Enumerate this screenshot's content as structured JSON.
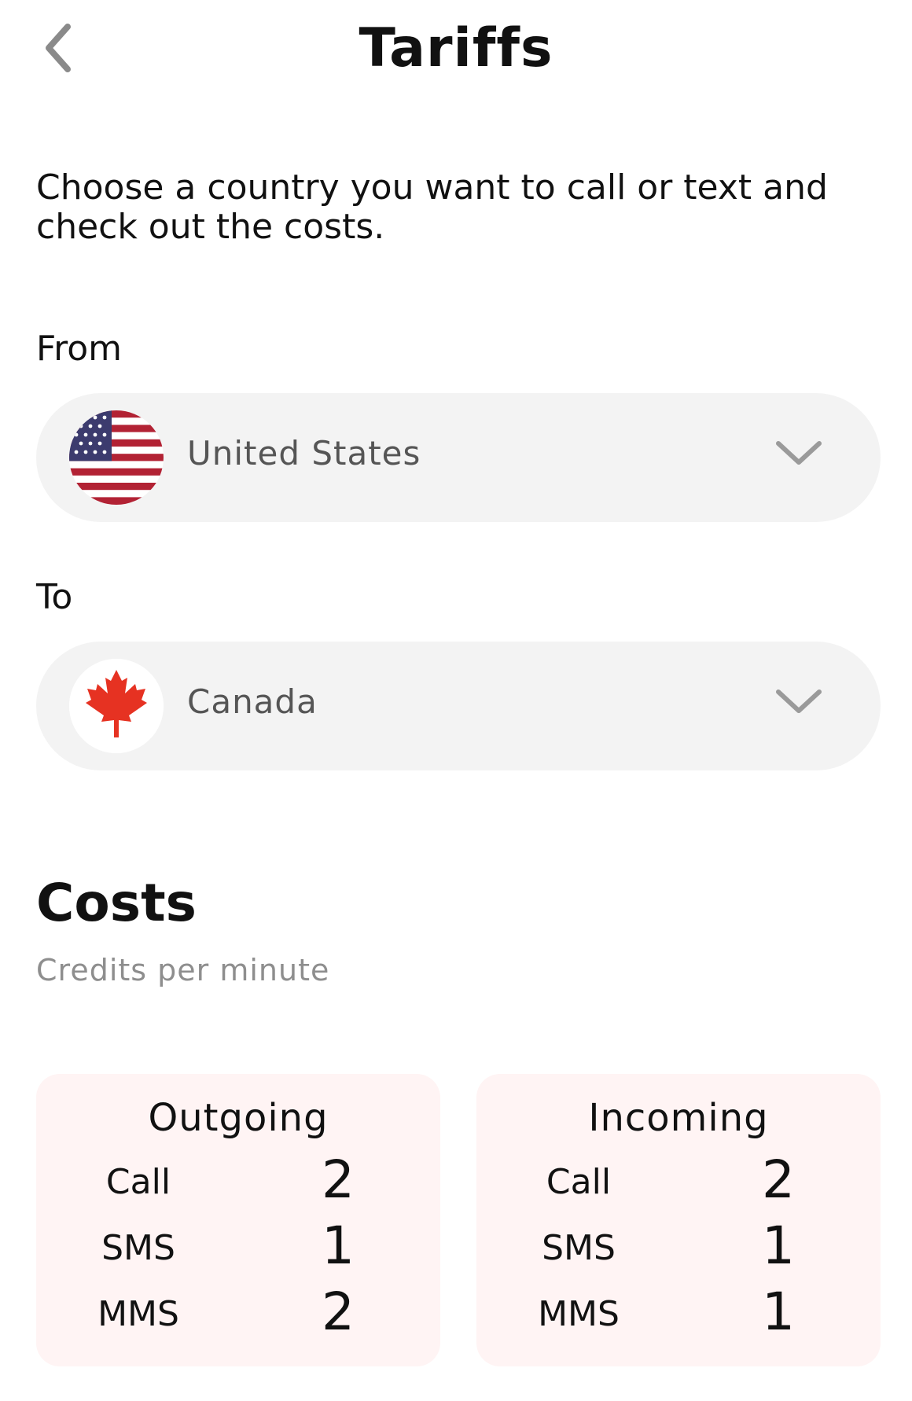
{
  "header": {
    "title": "Tariffs"
  },
  "intro_text": "Choose a country you want to call or text and check out the costs.",
  "from": {
    "label": "From",
    "country": "United States",
    "flag_icon": "us-flag-icon"
  },
  "to": {
    "label": "To",
    "country": "Canada",
    "flag_icon": "canada-flag-icon"
  },
  "costs": {
    "title": "Costs",
    "subtitle": "Credits per minute",
    "outgoing": {
      "title": "Outgoing",
      "rows": [
        {
          "label": "Call",
          "value": "2"
        },
        {
          "label": "SMS",
          "value": "1"
        },
        {
          "label": "MMS",
          "value": "2"
        }
      ]
    },
    "incoming": {
      "title": "Incoming",
      "rows": [
        {
          "label": "Call",
          "value": "2"
        },
        {
          "label": "SMS",
          "value": "1"
        },
        {
          "label": "MMS",
          "value": "1"
        }
      ]
    }
  },
  "colors": {
    "select_background": "#f3f3f3",
    "card_background": "#fff4f4",
    "chevron": "#9a9a9a",
    "flag_red": "#e63222",
    "us_red": "#b22234",
    "us_blue": "#3c3b6e"
  }
}
